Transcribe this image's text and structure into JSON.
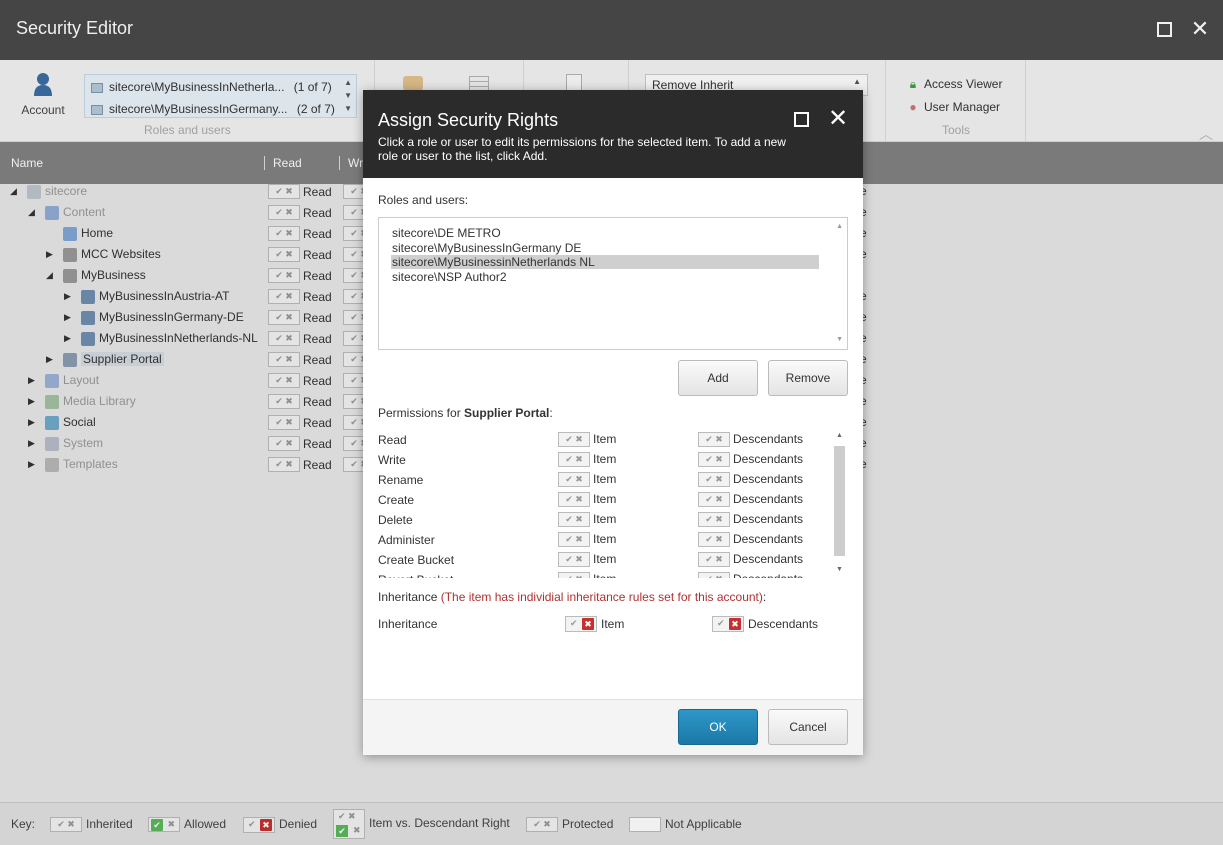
{
  "window": {
    "title": "Security Editor"
  },
  "ribbon": {
    "account_label": "Account",
    "roles_group_label": "Roles and users",
    "selected_users": [
      {
        "name": "sitecore\\MyBusinessInNetherla...",
        "count": "(1 of 7)"
      },
      {
        "name": "sitecore\\MyBusinessInGermany...",
        "count": "(2 of 7)"
      }
    ],
    "inherit_value": "Remove Inherit",
    "tools_group_label": "Tools",
    "tools": [
      "Access Viewer",
      "User Manager"
    ]
  },
  "columns": {
    "name": "Name",
    "read": "Read",
    "write": "Wr"
  },
  "tree": {
    "right_label": "Read",
    "tail_char": "e",
    "items": [
      {
        "label": "sitecore",
        "level": 0,
        "arrow": "◢",
        "dim": true
      },
      {
        "label": "Content",
        "level": 1,
        "arrow": "◢",
        "dim": true
      },
      {
        "label": "Home",
        "level": 2,
        "arrow": "",
        "dim": false
      },
      {
        "label": "MCC Websites",
        "level": 2,
        "arrow": "▶",
        "dim": false
      },
      {
        "label": "MyBusiness",
        "level": 2,
        "arrow": "◢",
        "dim": false
      },
      {
        "label": "MyBusinessInAustria-AT",
        "level": 3,
        "arrow": "▶",
        "dim": false
      },
      {
        "label": "MyBusinessInGermany-DE",
        "level": 3,
        "arrow": "▶",
        "dim": false
      },
      {
        "label": "MyBusinessInNetherlands-NL",
        "level": 3,
        "arrow": "▶",
        "dim": false
      },
      {
        "label": "Supplier Portal",
        "level": 2,
        "arrow": "▶",
        "dim": false,
        "selected": true
      },
      {
        "label": "Layout",
        "level": 1,
        "arrow": "▶",
        "dim": true
      },
      {
        "label": "Media Library",
        "level": 1,
        "arrow": "▶",
        "dim": true
      },
      {
        "label": "Social",
        "level": 1,
        "arrow": "▶",
        "dim": false
      },
      {
        "label": "System",
        "level": 1,
        "arrow": "▶",
        "dim": true
      },
      {
        "label": "Templates",
        "level": 1,
        "arrow": "▶",
        "dim": true
      }
    ]
  },
  "dialog": {
    "title": "Assign Security Rights",
    "description": "Click a role or user to edit its permissions for the selected item. To add a new role or user to the list, click Add.",
    "roles_label": "Roles and users:",
    "roles": [
      "sitecore\\DE METRO",
      "sitecore\\MyBusinessInGermany DE",
      "sitecore\\MyBusinessinNetherlands NL",
      "sitecore\\NSP Author2"
    ],
    "selected_role_index": 2,
    "add_label": "Add",
    "remove_label": "Remove",
    "permissions_prefix": "Permissions for ",
    "permissions_item": "Supplier Portal",
    "permissions_suffix": ":",
    "item_label": "Item",
    "descendants_label": "Descendants",
    "permissions": [
      "Read",
      "Write",
      "Rename",
      "Create",
      "Delete",
      "Administer",
      "Create Bucket",
      "Revert Bucket"
    ],
    "inheritance_title": "Inheritance",
    "inheritance_warning": "(The item has individial inheritance rules set for this account)",
    "inheritance_colon": ":",
    "inheritance_row_label": "Inheritance",
    "ok_label": "OK",
    "cancel_label": "Cancel"
  },
  "key": {
    "label": "Key:",
    "inherited": "Inherited",
    "allowed": "Allowed",
    "denied": "Denied",
    "item_vs_desc": "Item vs. Descendant Right",
    "protected": "Protected",
    "not_applicable": "Not Applicable"
  },
  "colors": {
    "titlebar": "#4a4a4a",
    "dialog_header": "#2b2b2b",
    "primary_button": "#1f86b8",
    "deny_red": "#c7302f",
    "allow_green": "#5cb85c",
    "warning_text": "#b03030"
  }
}
